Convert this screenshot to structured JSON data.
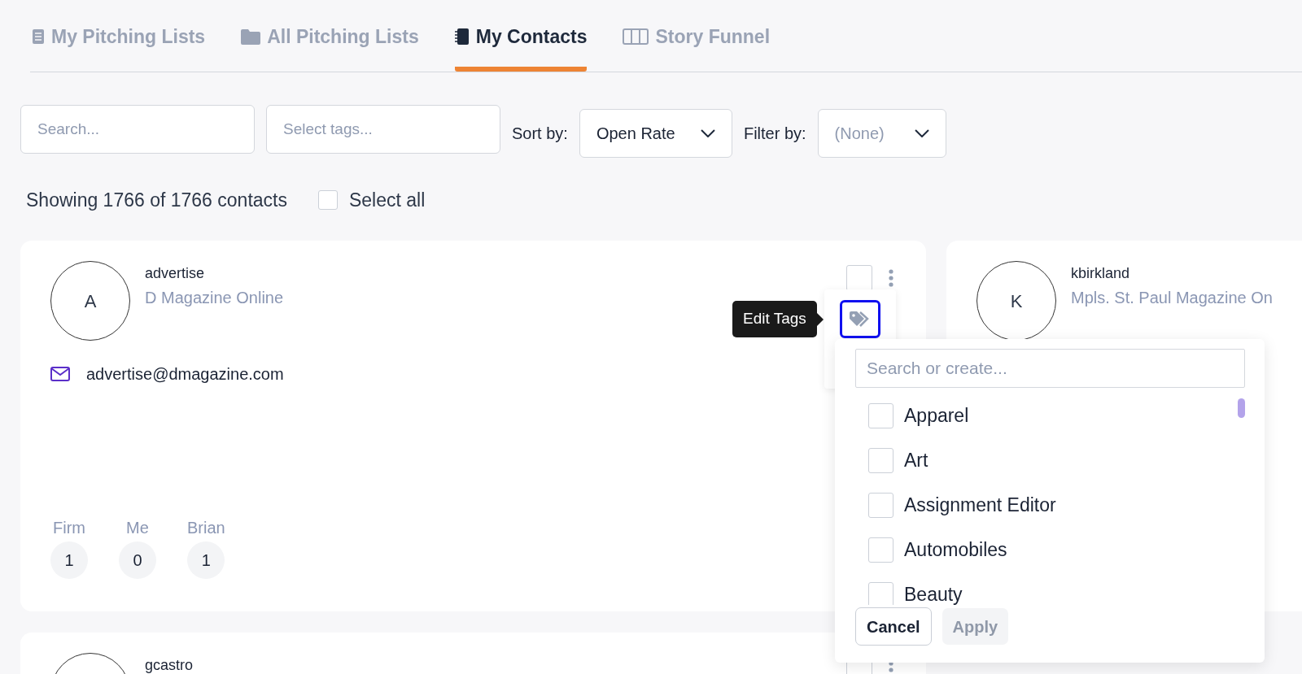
{
  "tabs": [
    {
      "label": "My Pitching Lists",
      "selected": false
    },
    {
      "label": "All Pitching Lists",
      "selected": false
    },
    {
      "label": "My Contacts",
      "selected": true
    },
    {
      "label": "Story Funnel",
      "selected": false
    }
  ],
  "toolbar": {
    "search": {
      "placeholder": "Search..."
    },
    "tags": {
      "placeholder": "Select tags..."
    },
    "sort": {
      "label": "Sort by:",
      "value": "Open Rate"
    },
    "filter": {
      "label": "Filter by:",
      "value": "(None)"
    }
  },
  "summary": {
    "text": "Showing 1766 of 1766 contacts",
    "select_all": {
      "label": "Select all",
      "checked": false
    }
  },
  "contacts": [
    {
      "initial": "A",
      "username": "advertise",
      "company": "D Magazine Online",
      "email": "advertise@dmagazine.com",
      "checked": false,
      "stats": [
        {
          "label": "Firm",
          "value": "1"
        },
        {
          "label": "Me",
          "value": "0"
        },
        {
          "label": "Brian",
          "value": "1"
        }
      ]
    },
    {
      "initial": "K",
      "username": "kbirkland",
      "company": "Mpls. St. Paul Magazine On"
    },
    {
      "username": "gcastro",
      "checked": false
    }
  ],
  "tooltip": {
    "text": "Edit Tags"
  },
  "tag_editor": {
    "search": {
      "placeholder": "Search or create..."
    },
    "tags": [
      {
        "label": "Apparel",
        "checked": false
      },
      {
        "label": "Art",
        "checked": false
      },
      {
        "label": "Assignment Editor",
        "checked": false
      },
      {
        "label": "Automobiles",
        "checked": false
      },
      {
        "label": "Beauty",
        "checked": false
      }
    ],
    "cancel": "Cancel",
    "apply": {
      "label": "Apply",
      "disabled": true
    }
  }
}
